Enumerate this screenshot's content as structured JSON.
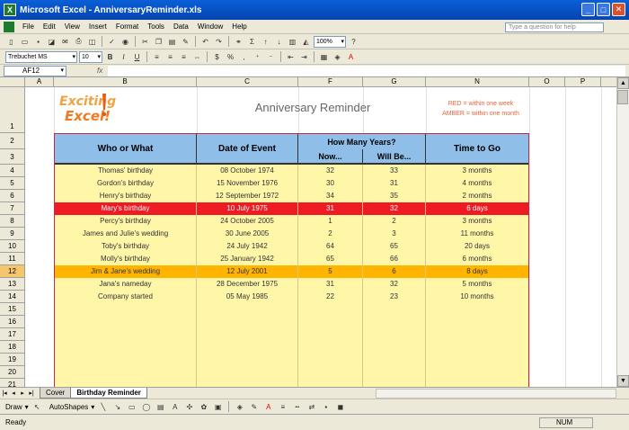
{
  "window": {
    "title": "Microsoft Excel - AnniversaryReminder.xls"
  },
  "menu": {
    "items": [
      "File",
      "Edit",
      "View",
      "Insert",
      "Format",
      "Tools",
      "Data",
      "Window",
      "Help"
    ],
    "help_placeholder": "Type a question for help"
  },
  "toolbar": {
    "zoom": "100%",
    "font": "Trebuchet MS",
    "size": "10"
  },
  "formula": {
    "namebox": "AF12",
    "fx": "fx"
  },
  "columns": [
    "A",
    "B",
    "C",
    "F",
    "G",
    "N",
    "O",
    "P"
  ],
  "rows": [
    "1",
    "2",
    "3",
    "4",
    "5",
    "6",
    "7",
    "8",
    "9",
    "10",
    "11",
    "12",
    "13",
    "14",
    "15",
    "16",
    "17",
    "18",
    "19",
    "20",
    "21"
  ],
  "sheet": {
    "logo_text_line1": "Exciting",
    "logo_text_line2": "Excel!",
    "title": "Anniversary Reminder",
    "legend_red": "RED = within one week",
    "legend_amber": "AMBER = within one month"
  },
  "table": {
    "headers": {
      "who": "Who or What",
      "date": "Date of Event",
      "years": "How Many Years?",
      "now": "Now...",
      "will_be": "Will Be...",
      "time_to_go": "Time to Go"
    },
    "rows": [
      {
        "who": "Thomas' birthday",
        "date": "08 October 1974",
        "now": "32",
        "will": "33",
        "time": "3 months",
        "status": "norm"
      },
      {
        "who": "Gordon's birthday",
        "date": "15 November 1976",
        "now": "30",
        "will": "31",
        "time": "4 months",
        "status": "norm"
      },
      {
        "who": "Henry's birthday",
        "date": "12 September 1972",
        "now": "34",
        "will": "35",
        "time": "2 months",
        "status": "norm"
      },
      {
        "who": "Mary's birthday",
        "date": "10 July 1975",
        "now": "31",
        "will": "32",
        "time": "6 days",
        "status": "red"
      },
      {
        "who": "Percy's birthday",
        "date": "24 October 2005",
        "now": "1",
        "will": "2",
        "time": "3 months",
        "status": "norm"
      },
      {
        "who": "James and Julie's wedding",
        "date": "30 June 2005",
        "now": "2",
        "will": "3",
        "time": "11 months",
        "status": "norm"
      },
      {
        "who": "Toby's birthday",
        "date": "24 July 1942",
        "now": "64",
        "will": "65",
        "time": "20 days",
        "status": "norm"
      },
      {
        "who": "Molly's birthday",
        "date": "25 January 1942",
        "now": "65",
        "will": "66",
        "time": "6 months",
        "status": "norm"
      },
      {
        "who": "Jim & Jane's wedding",
        "date": "12 July 2001",
        "now": "5",
        "will": "6",
        "time": "8 days",
        "status": "amber"
      },
      {
        "who": "Jana's nameday",
        "date": "28 December 1975",
        "now": "31",
        "will": "32",
        "time": "5 months",
        "status": "norm"
      },
      {
        "who": "Company started",
        "date": "05 May 1985",
        "now": "22",
        "will": "23",
        "time": "10 months",
        "status": "norm"
      }
    ]
  },
  "tabs": [
    "Cover",
    "Birthday Reminder"
  ],
  "drawbar": {
    "draw": "Draw",
    "autoshapes": "AutoShapes"
  },
  "status": {
    "ready": "Ready",
    "num": "NUM"
  },
  "colors": {
    "red": "#ee1b24",
    "amber": "#ffb400",
    "header": "#8fbfe9",
    "row": "#fff6a8"
  }
}
